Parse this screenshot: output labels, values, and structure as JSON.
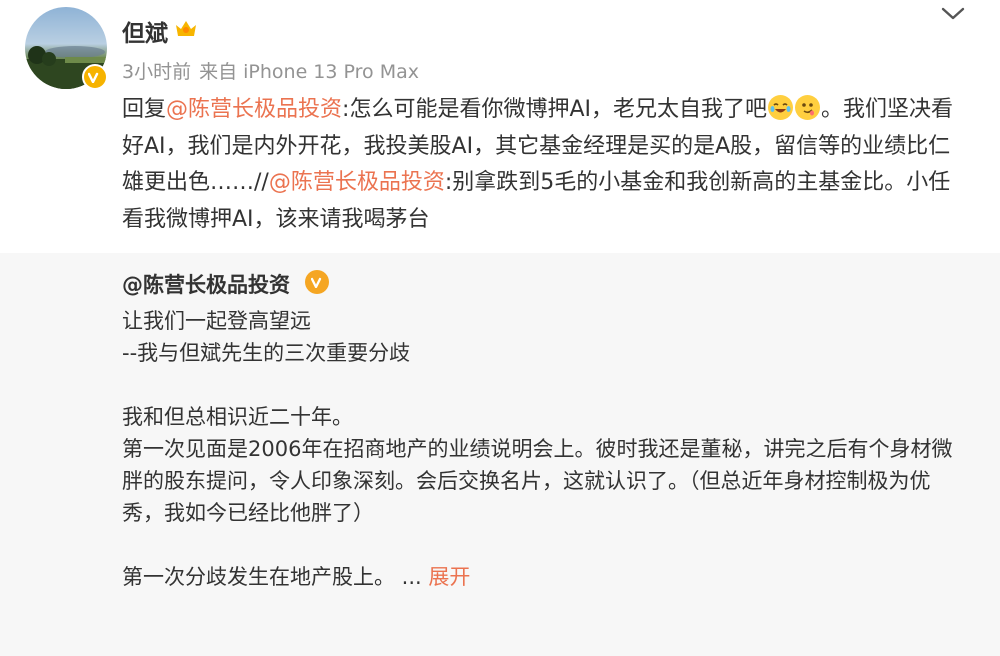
{
  "user": {
    "name": "但斌",
    "time": "3小时前",
    "source": "来自 iPhone 13 Pro Max"
  },
  "post": {
    "reply_prefix": "回复",
    "mention1": "@陈营长极品投资",
    "text1": ":怎么可能是看你微博押AI，老兄太自我了吧",
    "text2": "。我们坚决看好AI，我们是内外开花，我投美股AI，其它基金经理是买的是A股，留信等的业绩比仁雄更出色……//",
    "mention2": "@陈营长极品投资",
    "text3": ":别拿跌到5毛的小基金和我创新高的主基金比。小任看我微博押AI，该来请我喝茅台"
  },
  "repost": {
    "user": "@陈营长极品投资",
    "lines": [
      "让我们一起登高望远",
      "--我与但斌先生的三次重要分歧",
      "",
      "我和但总相识近二十年。",
      "第一次见面是2006年在招商地产的业绩说明会上。彼时我还是董秘，讲完之后有个身材微胖的股东提问，令人印象深刻。会后交换名片，这就认识了。（但总近年身材控制极为优秀，我如今已经比他胖了）",
      "",
      "第一次分歧发生在地产股上。"
    ],
    "ellipsis": " ... ",
    "expand": "展开"
  },
  "colors": {
    "mention": "#eb7350",
    "meta": "#939393",
    "repost_bg": "#f7f7f7",
    "badge": "#f6b300"
  }
}
